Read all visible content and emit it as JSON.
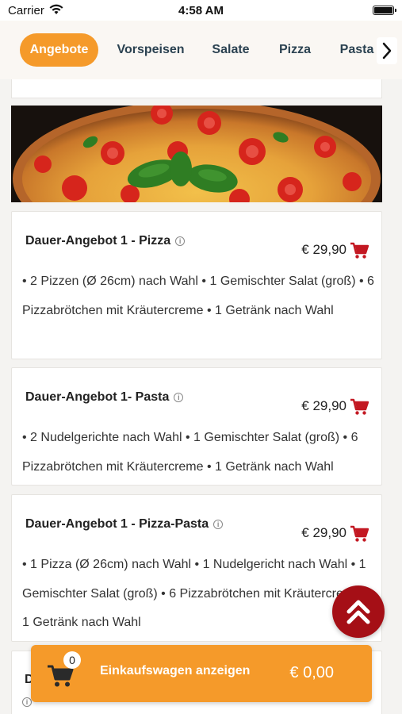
{
  "status_bar": {
    "carrier": "Carrier",
    "time": "4:58 AM"
  },
  "tabs": [
    {
      "label": "Angebote",
      "active": true
    },
    {
      "label": "Vorspeisen",
      "active": false
    },
    {
      "label": "Salate",
      "active": false
    },
    {
      "label": "Pizza",
      "active": false
    },
    {
      "label": "Pasta",
      "active": false
    }
  ],
  "offers": [
    {
      "title": "Dauer-Angebot 1 - Pizza",
      "price": "€ 29,90",
      "description": "• 2 Pizzen (Ø 26cm) nach Wahl • 1 Gemischter Salat (groß) • 6 Pizzabrötchen mit Kräutercreme • 1 Getränk nach Wahl"
    },
    {
      "title": "Dauer-Angebot 1- Pasta",
      "price": "€ 29,90",
      "description": "• 2 Nudelgerichte nach Wahl • 1 Gemischter Salat (groß) • 6 Pizzabrötchen mit Kräutercreme • 1 Getränk nach Wahl"
    },
    {
      "title": "Dauer-Angebot 1 - Pizza-Pasta",
      "price": "€ 29,90",
      "description": "• 1 Pizza (Ø 26cm) nach Wahl • 1 Nudelgericht nach Wahl • 1 Gemischter Salat (groß) • 6 Pizzabrötchen mit Kräutercreme • 1 Getränk nach Wahl"
    }
  ],
  "partial_card_title": "D",
  "cart_bar": {
    "count": "0",
    "label": "Einkaufswagen anzeigen",
    "total": "€ 0,00"
  },
  "colors": {
    "accent_orange": "#f59a2a",
    "brand_red": "#a50f16",
    "tab_text": "#2b4251"
  },
  "icons": [
    "wifi-icon",
    "battery-icon",
    "chevron-right-icon",
    "info-icon",
    "cart-icon",
    "double-chevron-up-icon"
  ]
}
